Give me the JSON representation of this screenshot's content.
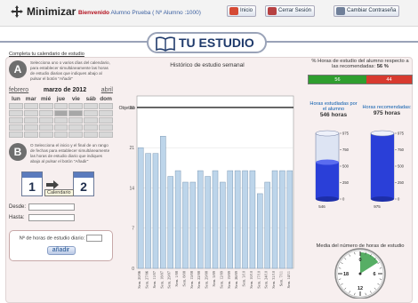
{
  "header": {
    "minimize_label": "Minimizar",
    "welcome_prefix": "Bienvenido",
    "welcome_user": "Alumno Prueba ( Nº Alumno :1000)",
    "buttons": [
      {
        "label": "Inicio",
        "color": "#d54a35"
      },
      {
        "label": "Cerrar Sesión",
        "color": "#b64041"
      },
      {
        "label": "Cambiar Contraseña",
        "color": "#6f7f99"
      }
    ]
  },
  "brand": {
    "title": "TU ESTUDIO"
  },
  "left": {
    "heading": "Completa tu calendario de estudio",
    "step_a": {
      "letter": "A",
      "text": "Selecciona uno o varios días del calendario, para establecer simultáneamente las horas de estudio diarias que indiques abajo al pulsar el botón \"Añadir\""
    },
    "step_b": {
      "letter": "B",
      "text": "O Selecciona el inicio y el final de un rango de fechas para establecer simultáneamente las horas de estudio diario que indiques abajo al pulsar el botón \"Añadir\""
    },
    "calendar": {
      "prev": "febrero",
      "current": "marzo de 2012",
      "next": "abril",
      "weekdays": [
        "lun",
        "mar",
        "mié",
        "jue",
        "vie",
        "sáb",
        "dom"
      ]
    },
    "mini_cal": {
      "from_day": "1",
      "to_day": "2",
      "tooltip": "Calendario"
    },
    "desde_label": "Desde:",
    "desde_value": "",
    "hasta_label": "Hasta:",
    "hasta_value": "",
    "hours_label": "Nº de horas de estudio diario:",
    "hours_value": "",
    "add_button": "añadir"
  },
  "chart_data": {
    "type": "bar",
    "title": "Histórico de estudio semanal",
    "objective_label": "Objetivo",
    "y_ticks": [
      0,
      7,
      14,
      21,
      28
    ],
    "ylim": [
      0,
      30
    ],
    "objective": 28,
    "categories": [
      "Sem. 20/06",
      "Sem. 27/06",
      "Sem. 11/07",
      "Sem. 18/07",
      "Sem. 29/07",
      "Sem. 1/08",
      "Sem. 8/08",
      "Sem. 15/08",
      "Sem. 22/08",
      "Sem. 29/08",
      "Sem. 5/09",
      "Sem. 12/09",
      "Sem. 19/09",
      "Sem. 26/09",
      "Sem. 3/10",
      "Sem. 10/10",
      "Sem. 17/10",
      "Sem. 24/10",
      "Sem. 31/10",
      "Sem. 7/11",
      "Sem. 14/11"
    ],
    "values": [
      21,
      20,
      20,
      23,
      16,
      17,
      15,
      15,
      17,
      16,
      17,
      15,
      17,
      17,
      17,
      17,
      13,
      15,
      17,
      17,
      17
    ],
    "colors": {
      "bar": "#bdd5ea",
      "bar_stroke": "#7f9ab5",
      "objective": "#222222"
    }
  },
  "right": {
    "pct_title": "% Horas de estudio del alumno respecto a las recomendadas:",
    "pct_value": "56 %",
    "pct_green": "56",
    "pct_red": "44",
    "studied_label": "Horas estudiadas por el alumno",
    "studied_value": "546 horas",
    "recommended_label": "Horas recomendadas:",
    "recommended_value": "975 horas",
    "scale": [
      "975",
      "750",
      "500",
      "250",
      "0"
    ],
    "studied_fraction": 0.56,
    "recommended_fraction": 1.0,
    "studied_caption": "546",
    "recommended_caption": "975",
    "avg_label": "Media del número de horas de estudio diarias:",
    "avg_value": "3,84 horas",
    "gauge_ticks": [
      "0",
      "6",
      "12",
      "18"
    ]
  }
}
